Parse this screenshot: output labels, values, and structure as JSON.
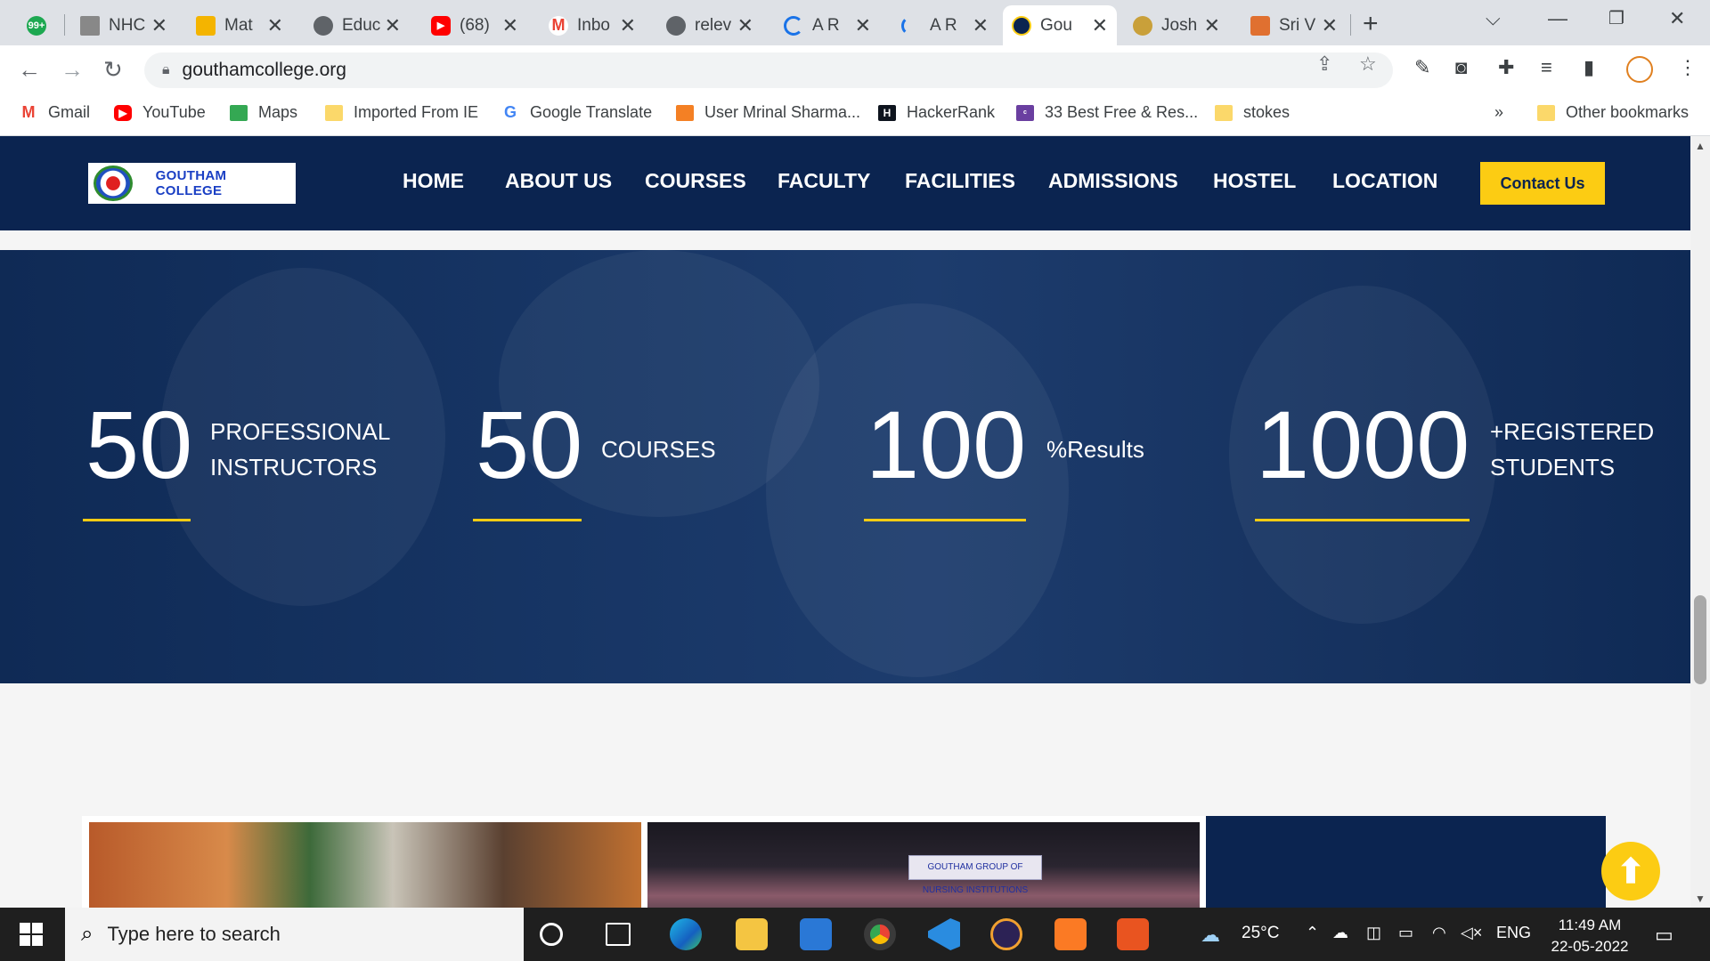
{
  "browser": {
    "tabs": [
      {
        "title": "",
        "fav_color": "#1da851",
        "fav_text": "99+",
        "active": false
      },
      {
        "title": "NHC",
        "fav_color": "#888888",
        "active": false
      },
      {
        "title": "Mat",
        "fav_color": "#f4b400",
        "active": false
      },
      {
        "title": "Educ",
        "fav_color": "#5f6368",
        "active": false
      },
      {
        "title": "(68)",
        "fav_color": "#ff0000",
        "active": false
      },
      {
        "title": "Inbo",
        "fav_color": "#ea4335",
        "active": false
      },
      {
        "title": "relev",
        "fav_color": "#5f6368",
        "active": false
      },
      {
        "title": "A R",
        "fav_color": "#1a73e8",
        "active": false
      },
      {
        "title": "A R",
        "fav_color": "#1a73e8",
        "active": false
      },
      {
        "title": "Gou",
        "fav_color": "#0b2450",
        "active": true
      },
      {
        "title": "Josh",
        "fav_color": "#c9a03a",
        "active": false
      },
      {
        "title": "Sri V",
        "fav_color": "#e07030",
        "active": false
      }
    ],
    "url": "gouthamcollege.org",
    "bookmarks": [
      {
        "label": "Gmail",
        "icon": "gmail-icon",
        "color": "#ea4335"
      },
      {
        "label": "YouTube",
        "icon": "youtube-icon",
        "color": "#ff0000"
      },
      {
        "label": "Maps",
        "icon": "maps-icon",
        "color": "#34a853"
      },
      {
        "label": "Imported From IE",
        "icon": "folder-icon",
        "color": "#fbd86a"
      },
      {
        "label": "Google Translate",
        "icon": "google-icon",
        "color": "#4285f4"
      },
      {
        "label": "User Mrinal Sharma...",
        "icon": "stackoverflow-icon",
        "color": "#f48024"
      },
      {
        "label": "HackerRank",
        "icon": "hackerrank-icon",
        "color": "#1ba94c"
      },
      {
        "label": "33 Best Free & Res...",
        "icon": "colorlib-icon",
        "color": "#6a3fa0"
      },
      {
        "label": "stokes",
        "icon": "folder-icon",
        "color": "#fbd86a"
      }
    ],
    "more_bookmarks": "»",
    "other_bookmarks": "Other bookmarks"
  },
  "site": {
    "logo_text": "GOUTHAM COLLEGE",
    "menu": [
      "HOME",
      "ABOUT US",
      "COURSES",
      "FACULTY",
      "FACILITIES",
      "ADMISSIONS",
      "HOSTEL",
      "LOCATION"
    ],
    "contact_label": "Contact Us",
    "accent": "#fccc13",
    "navy": "#0b2450",
    "stats": [
      {
        "number": "50",
        "label_line1": "PROFESSIONAL",
        "label_line2": "INSTRUCTORS"
      },
      {
        "number": "50",
        "label_line1": "COURSES",
        "label_line2": ""
      },
      {
        "number": "100",
        "label_line1": "%Results",
        "label_line2": ""
      },
      {
        "number": "1000",
        "label_line1": "+REGISTERED",
        "label_line2": "STUDENTS"
      }
    ],
    "gallery_banner_text": "GOUTHAM GROUP OF NURSING INSTITUTIONS"
  },
  "taskbar": {
    "search_placeholder": "Type here to search",
    "weather": "25°C",
    "language": "ENG",
    "time": "11:49 AM",
    "date": "22-05-2022"
  }
}
